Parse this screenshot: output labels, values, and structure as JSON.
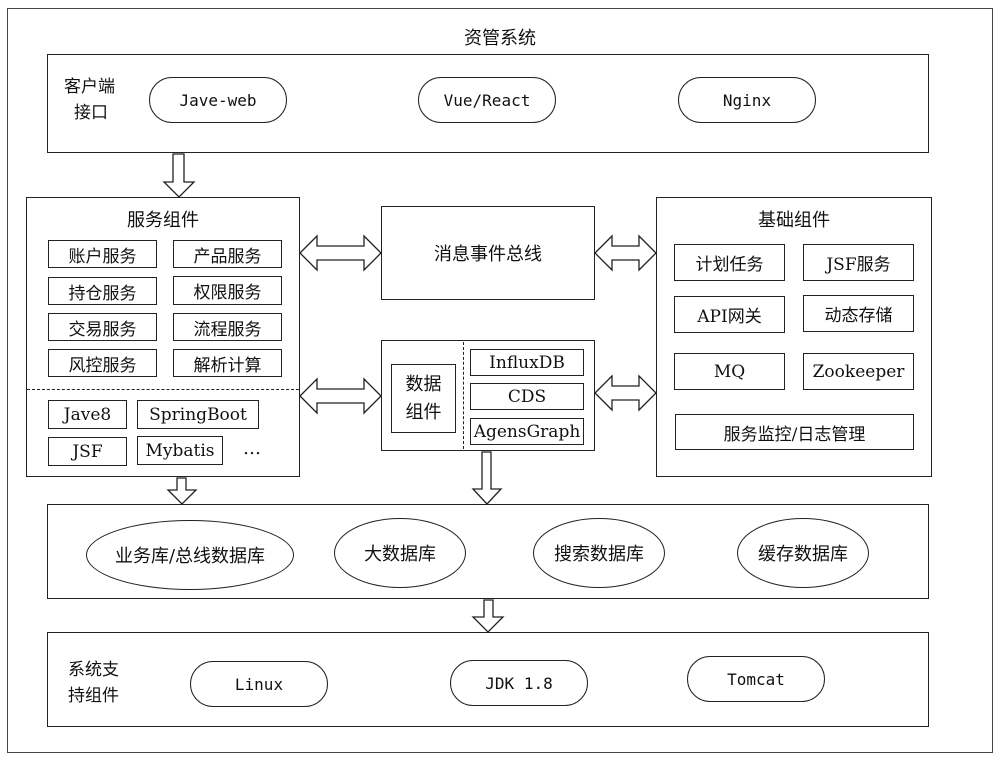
{
  "system_title": "资管系统",
  "client_layer": {
    "label_line1": "客户端",
    "label_line2": "接口",
    "items": [
      "Jave-web",
      "Vue/React",
      "Nginx"
    ]
  },
  "service_components": {
    "title": "服务组件",
    "services": [
      "账户服务",
      "产品服务",
      "持仓服务",
      "权限服务",
      "交易服务",
      "流程服务",
      "风控服务",
      "解析计算"
    ],
    "frameworks": [
      "Jave8",
      "SpringBoot",
      "JSF",
      "Mybatis"
    ],
    "more": "…"
  },
  "message_bus": {
    "label": "消息事件总线"
  },
  "data_components": {
    "label_line1": "数据",
    "label_line2": "组件",
    "items": [
      "InfluxDB",
      "CDS",
      "AgensGraph"
    ]
  },
  "base_components": {
    "title": "基础组件",
    "items": [
      "计划任务",
      "JSF服务",
      "API网关",
      "动态存储",
      "MQ",
      "Zookeeper"
    ],
    "wide_item": "服务监控/日志管理"
  },
  "databases": {
    "items": [
      "业务库/总线数据库",
      "大数据库",
      "搜索数据库",
      "缓存数据库"
    ]
  },
  "system_support": {
    "label_line1": "系统支",
    "label_line2": "持组件",
    "items": [
      "Linux",
      "JDK 1.8",
      "Tomcat"
    ]
  }
}
